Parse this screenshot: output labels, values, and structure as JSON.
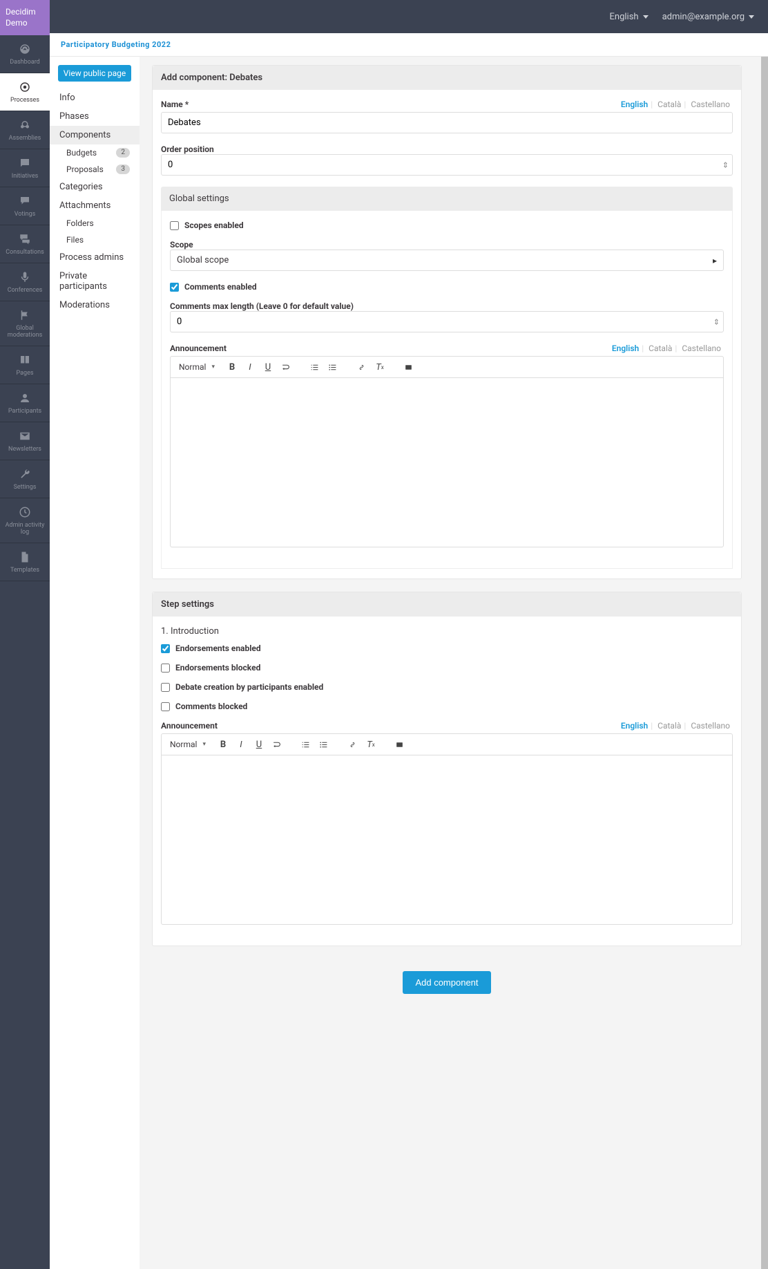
{
  "logo": "Decidim Demo",
  "topbar": {
    "language": "English",
    "user": "admin@example.org"
  },
  "mainNav": [
    {
      "id": "dashboard",
      "label": "Dashboard"
    },
    {
      "id": "processes",
      "label": "Processes"
    },
    {
      "id": "assemblies",
      "label": "Assemblies"
    },
    {
      "id": "initiatives",
      "label": "Initiatives"
    },
    {
      "id": "votings",
      "label": "Votings"
    },
    {
      "id": "consultations",
      "label": "Consultations"
    },
    {
      "id": "conferences",
      "label": "Conferences"
    },
    {
      "id": "global-moderations",
      "label": "Global moderations"
    },
    {
      "id": "pages",
      "label": "Pages"
    },
    {
      "id": "participants",
      "label": "Participants"
    },
    {
      "id": "newsletters",
      "label": "Newsletters"
    },
    {
      "id": "settings",
      "label": "Settings"
    },
    {
      "id": "admin-activity-log",
      "label": "Admin activity log"
    },
    {
      "id": "templates",
      "label": "Templates"
    }
  ],
  "breadcrumb": "Participatory Budgeting 2022",
  "subNav": {
    "viewPublic": "View public page",
    "items": [
      {
        "label": "Info"
      },
      {
        "label": "Phases"
      },
      {
        "label": "Components",
        "active": true,
        "children": [
          {
            "label": "Budgets",
            "badge": "2"
          },
          {
            "label": "Proposals",
            "badge": "3"
          }
        ]
      },
      {
        "label": "Categories"
      },
      {
        "label": "Attachments",
        "children": [
          {
            "label": "Folders"
          },
          {
            "label": "Files"
          }
        ]
      },
      {
        "label": "Process admins"
      },
      {
        "label": "Private participants"
      },
      {
        "label": "Moderations"
      }
    ]
  },
  "page": {
    "title": "Add component: Debates",
    "nameLabel": "Name *",
    "nameValue": "Debates",
    "langTabs": [
      "English",
      "Català",
      "Castellano"
    ],
    "orderPositionLabel": "Order position",
    "orderPositionValue": "0",
    "globalSettingsTitle": "Global settings",
    "scopesEnabled": "Scopes enabled",
    "scopeLabel": "Scope",
    "scopeValue": "Global scope",
    "commentsEnabled": "Comments enabled",
    "commentsMaxLabel": "Comments max length (Leave 0 for default value)",
    "commentsMaxValue": "0",
    "announcementLabel": "Announcement",
    "editorFormat": "Normal",
    "stepSettingsTitle": "Step settings",
    "stepName": "1. Introduction",
    "endorsementsEnabled": "Endorsements enabled",
    "endorsementsBlocked": "Endorsements blocked",
    "debateCreation": "Debate creation by participants enabled",
    "commentsBlocked": "Comments blocked",
    "submitLabel": "Add component"
  }
}
